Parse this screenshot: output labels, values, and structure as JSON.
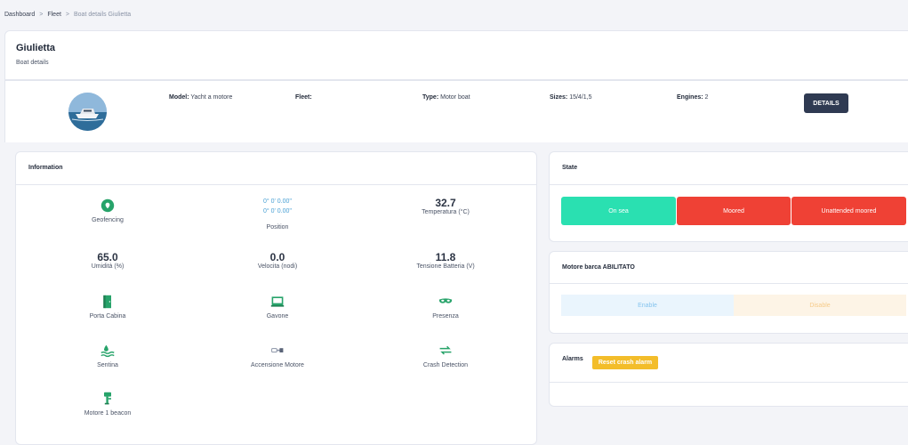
{
  "breadcrumb": {
    "items": [
      "Dashboard",
      "Fleet",
      "Boat details Giulietta"
    ],
    "sep": ">"
  },
  "header": {
    "title": "Giulietta",
    "subtitle": "Boat details"
  },
  "specs": {
    "model_label": "Model:",
    "model_value": "Yacht a motore",
    "fleet_label": "Fleet:",
    "fleet_value": "",
    "type_label": "Type:",
    "type_value": "Motor boat",
    "sizes_label": "Sizes:",
    "sizes_value": "15/4/1,5",
    "engines_label": "Engines:",
    "engines_value": "2",
    "details_button": "DETAILS"
  },
  "information": {
    "title": "Information",
    "geofencing": "Geofencing",
    "position_lat": "0° 0' 0.00''",
    "position_lon": "0° 0' 0.00''",
    "position_label": "Position",
    "temperature_value": "32.7",
    "temperature_label": "Temperatura (°C)",
    "humidity_value": "65.0",
    "humidity_label": "Umidità (%)",
    "speed_value": "0.0",
    "speed_label": "Velocita (nodi)",
    "battery_value": "11.8",
    "battery_label": "Tensione Batteria (V)",
    "porta_cabina": "Porta Cabina",
    "gavone": "Gavone",
    "presenza": "Presenza",
    "sentina": "Sentina",
    "accensione_motore": "Accensione Motore",
    "crash_detection": "Crash Detection",
    "motore_beacon": "Motore 1 beacon"
  },
  "state": {
    "title": "State",
    "on_sea": "On sea",
    "moored": "Moored",
    "unattended": "Unattended moored"
  },
  "engine": {
    "title": "Motore barca ABILITATO",
    "enable": "Enable",
    "disable": "Disable"
  },
  "alarms": {
    "title": "Alarms",
    "reset": "Reset crash alarm"
  },
  "colors": {
    "accent_green": "#27a36a",
    "on_sea": "#2ae0b1",
    "moored": "#ef4135",
    "dark_button": "#2f3a52",
    "reset": "#f3bd2a"
  }
}
